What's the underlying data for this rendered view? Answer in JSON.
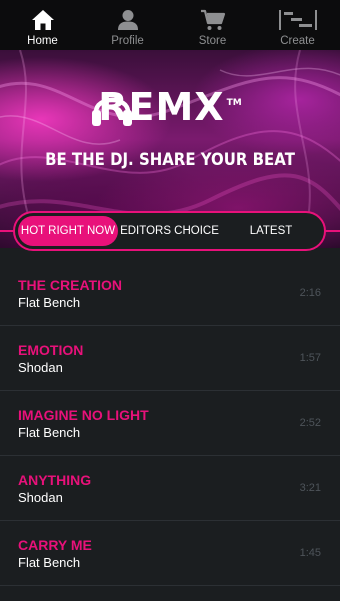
{
  "nav": {
    "items": [
      {
        "label": "Home",
        "icon": "home-icon"
      },
      {
        "label": "Profile",
        "icon": "profile-icon"
      },
      {
        "label": "Store",
        "icon": "cart-icon"
      },
      {
        "label": "Create",
        "icon": "create-icon"
      }
    ],
    "active": "Home"
  },
  "hero": {
    "logo": "REMX",
    "trademark": "TM",
    "tagline": "BE THE DJ. SHARE YOUR BEAT"
  },
  "tabs": [
    {
      "label": "HOT RIGHT NOW",
      "selected": true
    },
    {
      "label": "EDITORS CHOICE",
      "selected": false
    },
    {
      "label": "LATEST",
      "selected": false
    }
  ],
  "tracks": [
    {
      "title": "THE CREATION",
      "artist": "Flat Bench",
      "duration": "2:16"
    },
    {
      "title": "EMOTION",
      "artist": "Shodan",
      "duration": "1:57"
    },
    {
      "title": "IMAGINE NO LIGHT",
      "artist": "Flat Bench",
      "duration": "2:52"
    },
    {
      "title": "ANYTHING",
      "artist": "Shodan",
      "duration": "3:21"
    },
    {
      "title": "CARRY ME",
      "artist": "Flat Bench",
      "duration": "1:45"
    }
  ],
  "colors": {
    "accent": "#e8117a",
    "background": "#1b1e20",
    "nav_background": "#0c0c0d",
    "muted": "#8e8f91"
  }
}
